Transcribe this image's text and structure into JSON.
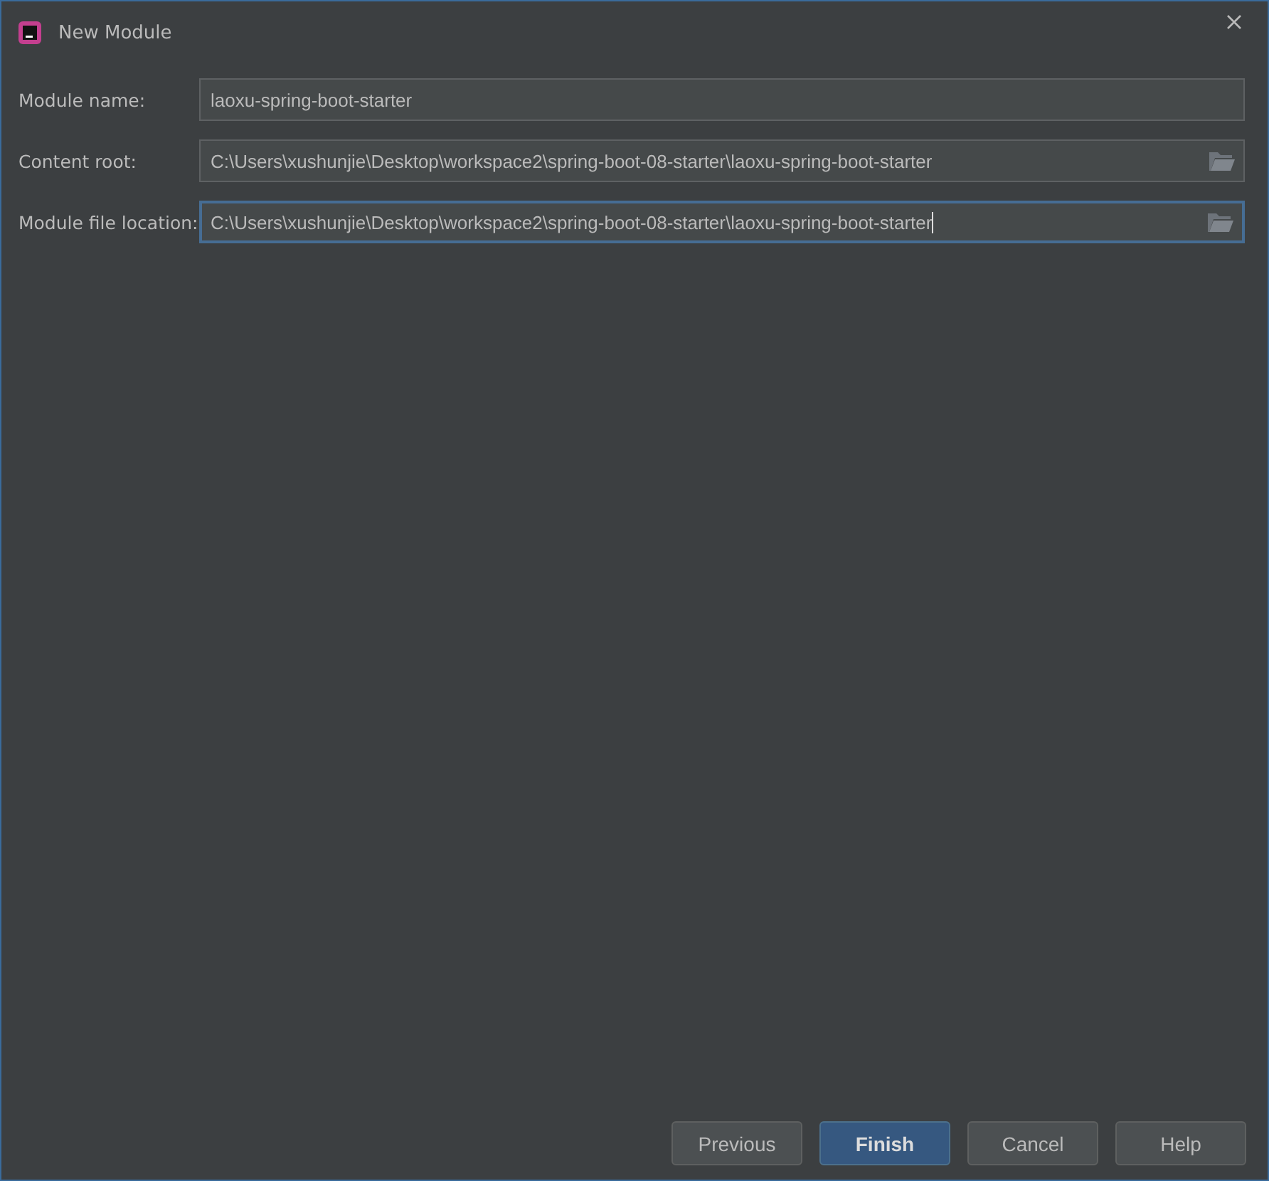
{
  "window": {
    "title": "New Module"
  },
  "fields": [
    {
      "label": "Module name:",
      "value": "laoxu-spring-boot-starter",
      "kind": "text",
      "focused": false
    },
    {
      "label": "Content root:",
      "value": "C:\\Users\\xushunjie\\Desktop\\workspace2\\spring-boot-08-starter\\laoxu-spring-boot-starter",
      "kind": "path",
      "focused": false
    },
    {
      "label": "Module file location:",
      "value": "C:\\Users\\xushunjie\\Desktop\\workspace2\\spring-boot-08-starter\\laoxu-spring-boot-starter",
      "kind": "path",
      "focused": true
    }
  ],
  "buttons": [
    {
      "label": "Previous",
      "default": false
    },
    {
      "label": "Finish",
      "default": true
    },
    {
      "label": "Cancel",
      "default": false
    },
    {
      "label": "Help",
      "default": false
    }
  ]
}
